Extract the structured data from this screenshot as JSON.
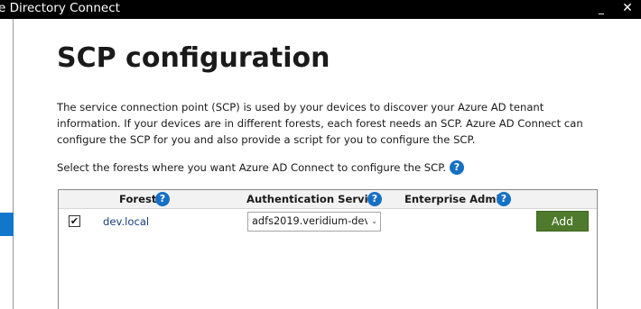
{
  "window": {
    "title": "e Directory Connect",
    "minimize_glyph": "_",
    "close_glyph": "✕"
  },
  "page": {
    "title": "SCP configuration",
    "description_lines": [
      "The service connection point (SCP) is used by your devices to discover your Azure AD tenant",
      "information.  If your devices are in different forests, each forest needs an SCP.  Azure AD Connect can",
      "configure the SCP for you and also provide a script for you to configure the SCP."
    ],
    "select_forests_text": "Select the forests where you want Azure AD Connect to configure the SCP."
  },
  "icons": {
    "help": {
      "name": "help-icon",
      "glyph": "?"
    },
    "checkmark": {
      "name": "checkmark-icon",
      "glyph": "✔"
    },
    "chevron": {
      "name": "chevron-down-icon",
      "glyph": "⌄"
    }
  },
  "grid": {
    "columns": {
      "forest": "Forest",
      "auth_service": "Authentication Service",
      "enterprise_admin": "Enterprise Admin"
    },
    "rows": [
      {
        "checked": true,
        "forest": "dev.local",
        "auth_service": "adfs2019.veridium-dev",
        "enterprise_admin": "",
        "add_label": "Add"
      }
    ]
  },
  "colors": {
    "accent": "#1670c5",
    "add_button": "#4f7a2d",
    "sidebar_selected": "#1177cc"
  }
}
